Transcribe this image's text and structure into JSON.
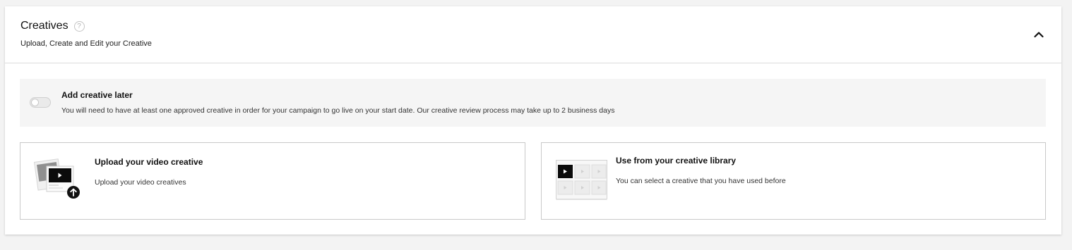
{
  "header": {
    "title": "Creatives",
    "help_glyph": "?",
    "subtitle": "Upload, Create and Edit your Creative",
    "collapse_icon": "chevron-up-icon"
  },
  "toggle": {
    "title": "Add creative later",
    "description": "You will need to have at least one approved creative in order for your campaign to go live on your start date. Our creative review process may take up to 2 business days",
    "enabled": false
  },
  "cards": {
    "upload": {
      "title": "Upload your video creative",
      "description": "Upload your video creatives",
      "icon": "video-upload-icon"
    },
    "library": {
      "title": "Use from your creative library",
      "description": "You can select a creative that you have used before",
      "icon": "creative-library-icon"
    }
  },
  "colors": {
    "background": "#f3f3f3",
    "panel": "#ffffff",
    "toggle_section": "#f5f5f5",
    "border": "#c9c9c9",
    "text": "#111111"
  }
}
